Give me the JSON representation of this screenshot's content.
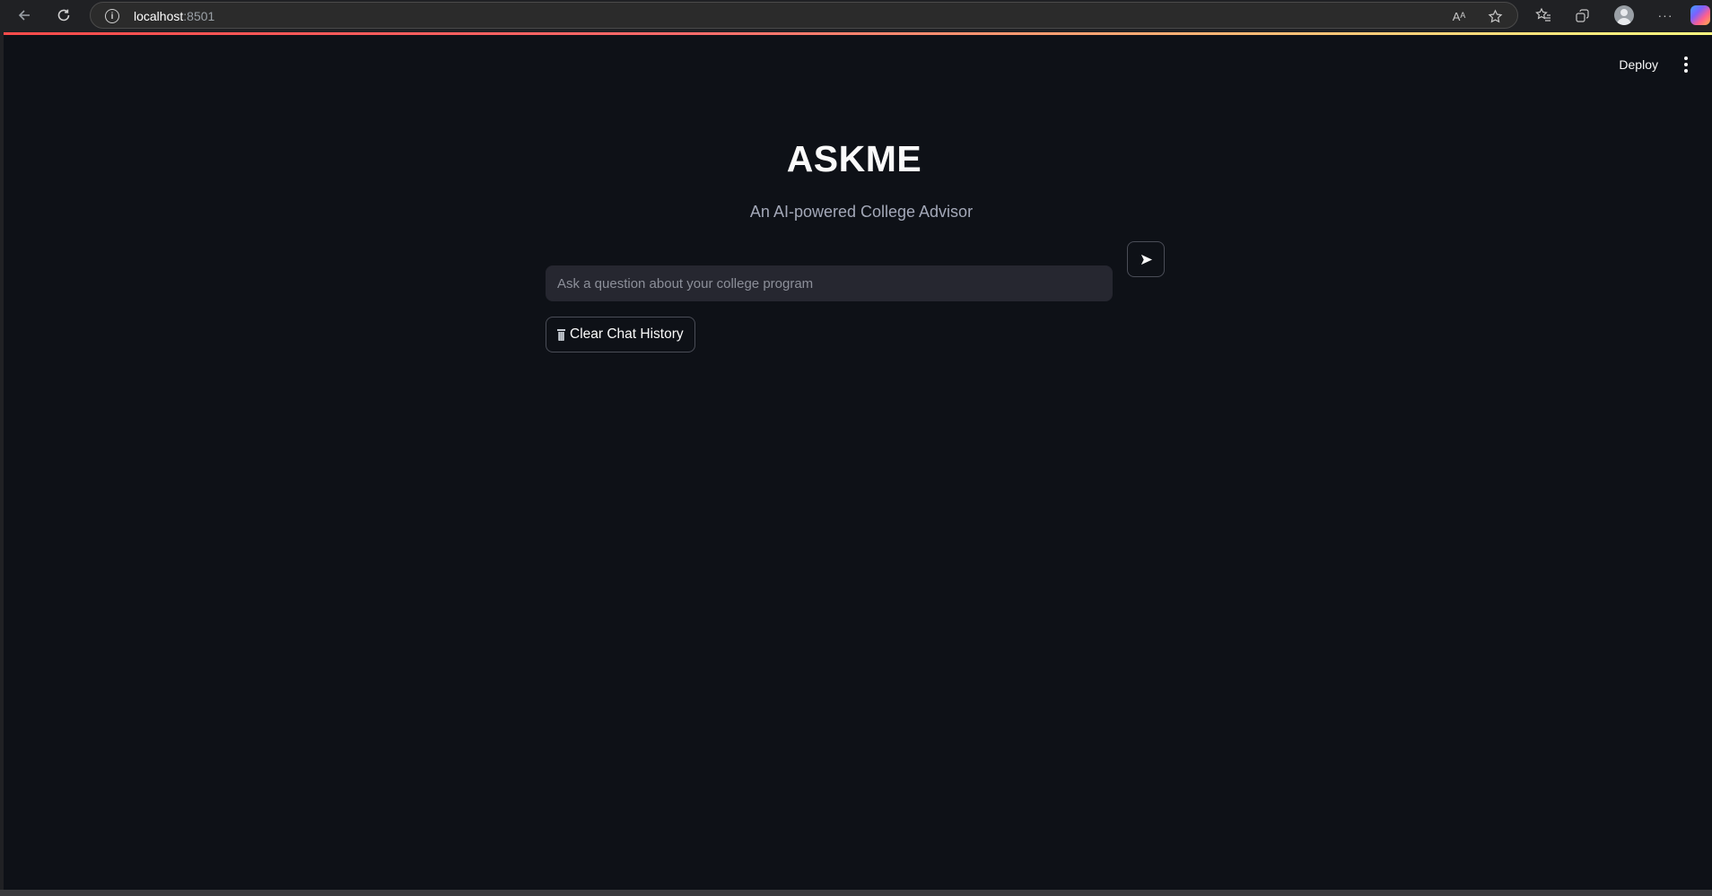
{
  "browser": {
    "url_host": "localhost",
    "url_port": ":8501",
    "icons": {
      "back": "back-arrow-icon",
      "reload": "reload-icon",
      "site_info": "info-icon",
      "read_aloud": "read-aloud-icon",
      "favorite": "star-icon",
      "favorites": "favorites-icon",
      "collections": "collections-icon",
      "profile": "profile-avatar-icon",
      "more": "more-horizontal-icon",
      "copilot": "copilot-icon"
    },
    "read_aloud_label": "Aᴬ",
    "more_label": "···"
  },
  "app": {
    "deploy_label": "Deploy",
    "menu_icon": "vertical-dots-icon",
    "title": "ASKME",
    "subtitle": "An AI-powered College Advisor",
    "send_icon": "send-arrow-icon",
    "question_placeholder": "Ask a question about your college program",
    "question_value": "",
    "clear_label": "Clear Chat History",
    "clear_icon": "trash-icon"
  },
  "colors": {
    "background": "#0e1117",
    "input_background": "#262730",
    "text": "#fafafa",
    "subtitle": "#a3a8b8",
    "accent_red": "#ff4b4b",
    "accent_yellow": "#fffd80"
  }
}
